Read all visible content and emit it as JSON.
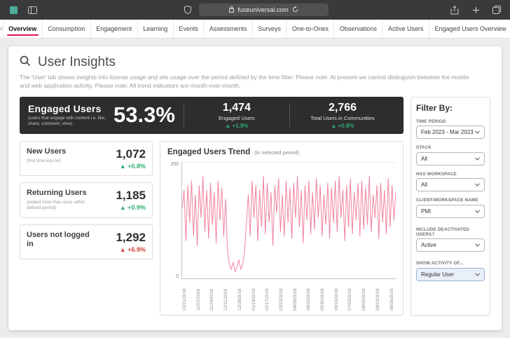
{
  "browser": {
    "url": "fuseuniversal.com"
  },
  "nav_tabs": {
    "items": [
      "Overview",
      "Consumption",
      "Engagement",
      "Learning",
      "Events",
      "Assessments",
      "Surveys",
      "One-to-Ones",
      "Observations",
      "Active Users",
      "Engaged Users Overview"
    ],
    "active": "Overview"
  },
  "header": {
    "title": "User Insights",
    "description": "The 'User' tab shows insights into license usage and site usage over the period defined by the time filter. Please note: At present we cannot distinguish between the mobile and web application activity. Please note: All trend indicators are month-over-month."
  },
  "banner": {
    "title": "Engaged Users",
    "subtitle": "(users that engage with content i.e. like, share, comment, view)",
    "percent": "53.3%",
    "stats": [
      {
        "value": "1,474",
        "label": "Engaged Users",
        "delta": "▲ +1.9%",
        "trend": "good"
      },
      {
        "value": "2,766",
        "label": "Total Users in Communities",
        "delta": "▲ +0.8%",
        "trend": "good"
      }
    ]
  },
  "cards": [
    {
      "title": "New Users",
      "subtitle": "(first time log-ins)",
      "value": "1,072",
      "delta": "▲ +0.8%",
      "trend": "good"
    },
    {
      "title": "Returning Users",
      "subtitle": "(visited more than once within defined period)",
      "value": "1,185",
      "delta": "▲ +0.9%",
      "trend": "good"
    },
    {
      "title": "Users not logged in",
      "subtitle": "",
      "value": "1,292",
      "delta": "▲ +6.9%",
      "trend": "bad"
    }
  ],
  "filters": {
    "title": "Filter By:",
    "groups": [
      {
        "label": "TIME PERIOD",
        "value": "Feb 2023 - Mar 2023"
      },
      {
        "label": "STACK",
        "value": "All"
      },
      {
        "label": "HAS WORKSPACE",
        "value": "All"
      },
      {
        "label": "CLIENT/WORKSPACE NAME",
        "value": "PMI"
      },
      {
        "label": "INCLUDE DEACTIVATED USERS?",
        "value": "Active"
      },
      {
        "label": "SHOW ACTIVITY OF...",
        "value": "Regular User"
      }
    ]
  },
  "chart_data": {
    "type": "line",
    "title": "Engaged Users Trend",
    "subtitle": "(in selected period)",
    "ylabel": "",
    "xlabel": "",
    "ylim": [
      0,
      250
    ],
    "y_ticks": [
      "250",
      "0"
    ],
    "series_color": "#f2849e",
    "x_labels": [
      "10/21/2018",
      "11/07/2018",
      "11/24/2018",
      "12/11/2018",
      "12/28/2018",
      "01/14/2019",
      "02/17/2019",
      "03/23/2019",
      "04/09/2019",
      "04/26/2019",
      "05/30/2019",
      "06/16/2019",
      "07/03/2019",
      "08/06/2019",
      "08/23/2019",
      "09/26/2019"
    ],
    "values": [
      150,
      190,
      80,
      200,
      120,
      210,
      90,
      180,
      70,
      200,
      130,
      220,
      100,
      190,
      85,
      205,
      115,
      185,
      75,
      210,
      125,
      195,
      90,
      170,
      60,
      30,
      20,
      35,
      15,
      25,
      40,
      20,
      30,
      55,
      120,
      180,
      90,
      210,
      130,
      200,
      80,
      190,
      110,
      220,
      95,
      205,
      120,
      185,
      70,
      200,
      140,
      215,
      100,
      180,
      90,
      210,
      120,
      195,
      85,
      205,
      130,
      220,
      110,
      190,
      75,
      200,
      125,
      210,
      95,
      185,
      105,
      215,
      130,
      200,
      90,
      180,
      115,
      205,
      85,
      195,
      120,
      210,
      100,
      220,
      130,
      190,
      80,
      200,
      110,
      215,
      95,
      185,
      125,
      205,
      90,
      210,
      105,
      195,
      115,
      220,
      100,
      180,
      130,
      200,
      85,
      205,
      120,
      190,
      95,
      215,
      110,
      200,
      125,
      185
    ]
  },
  "colors": {
    "accent_pink": "#e0135f",
    "positive_green": "#2fae74",
    "negative_red": "#cf4436",
    "banner_bg": "#2d2d2d"
  }
}
